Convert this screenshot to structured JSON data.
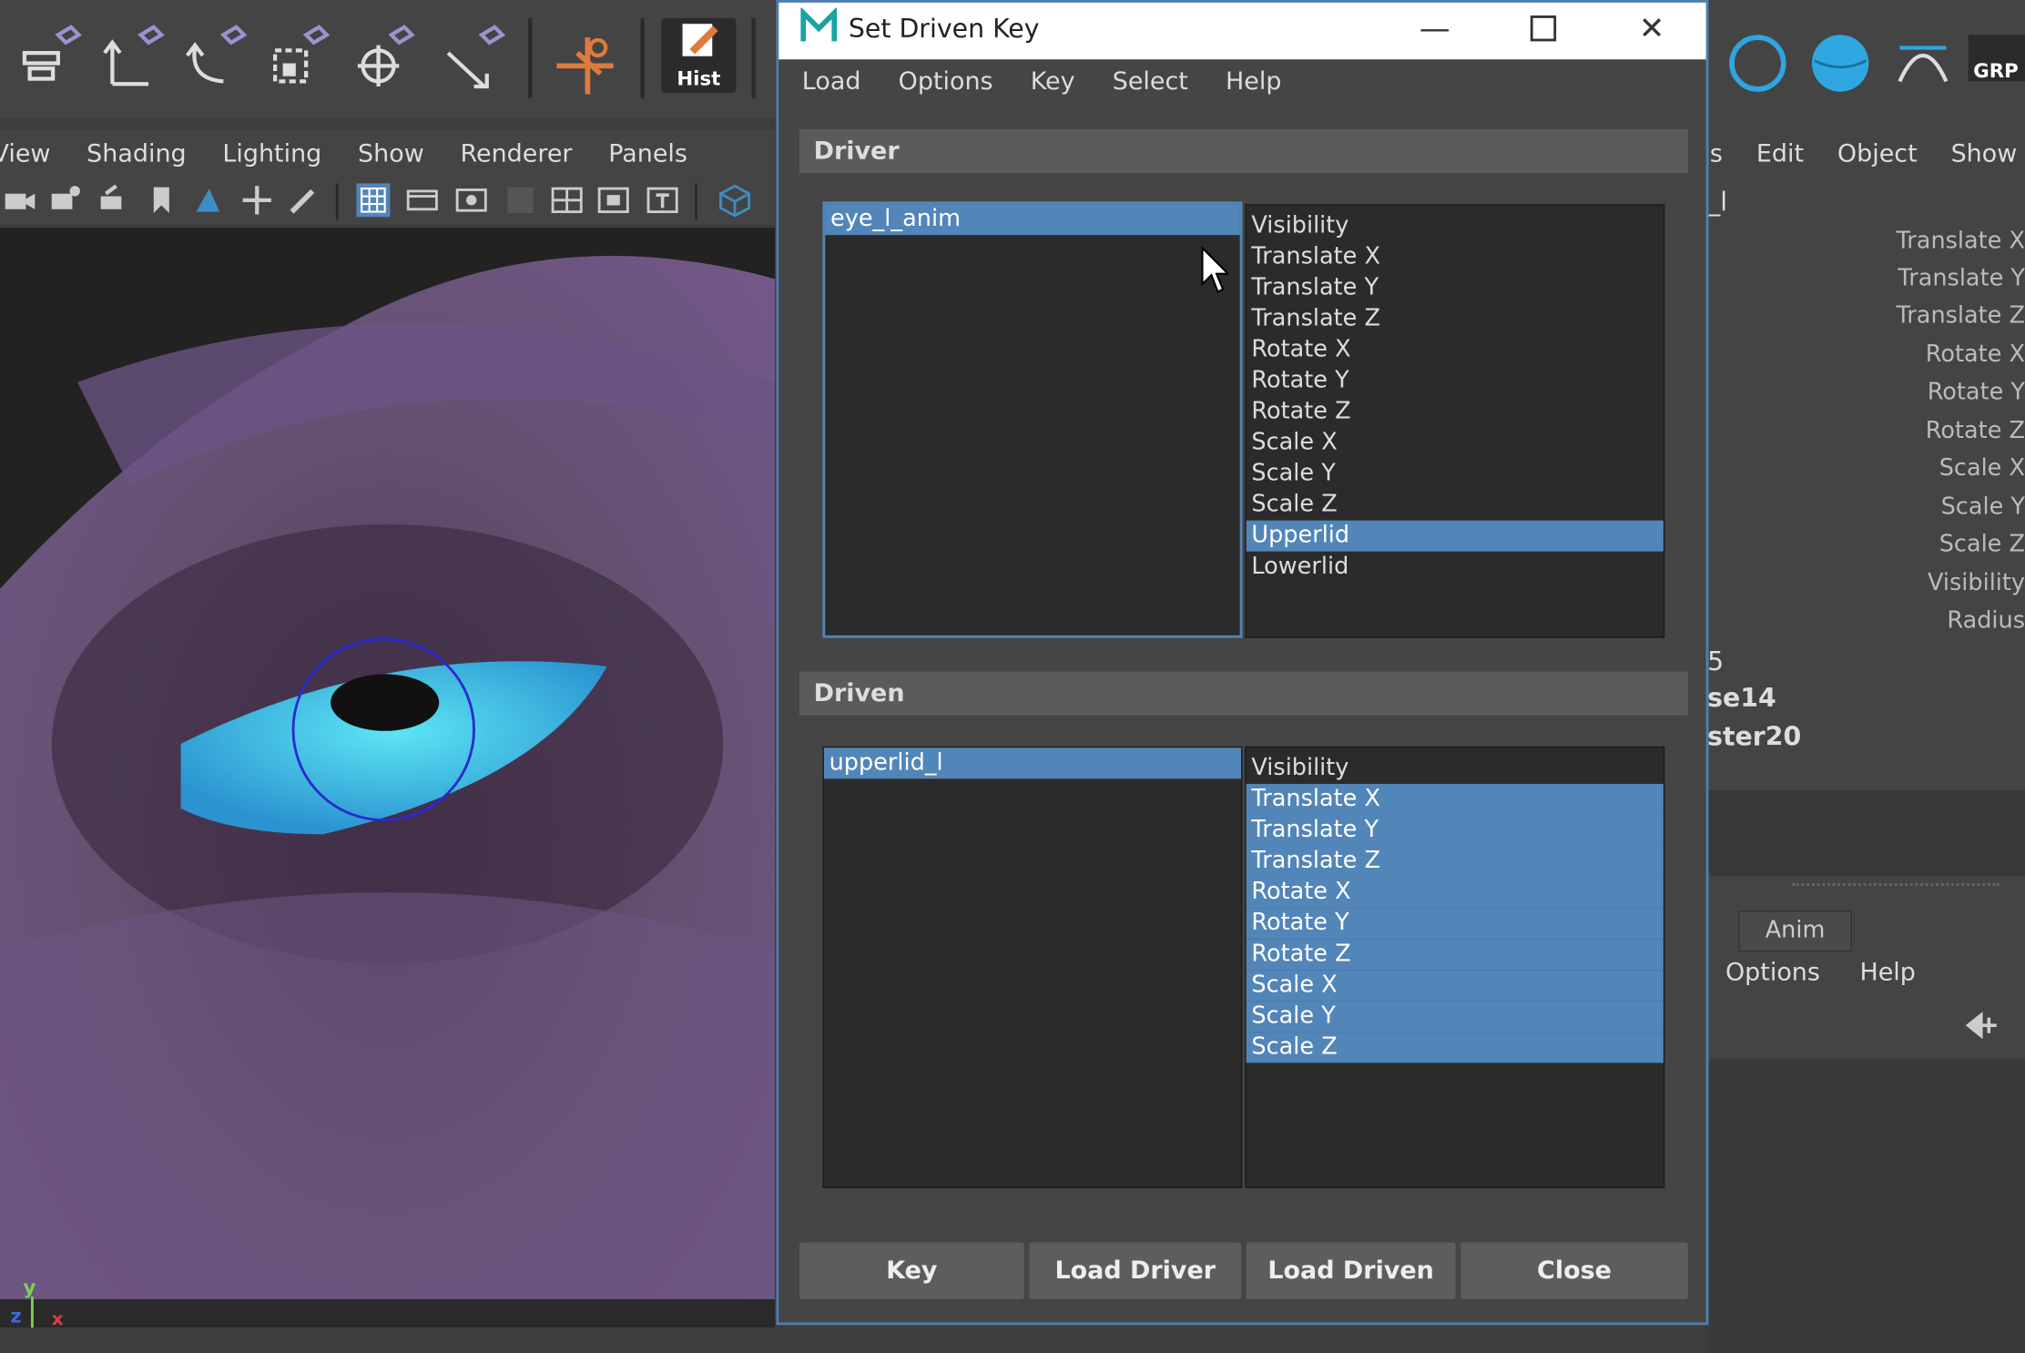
{
  "shelf": {
    "hist_label": "Hist",
    "grp_label": "GRP"
  },
  "viewport": {
    "menu": [
      "View",
      "Shading",
      "Lighting",
      "Show",
      "Renderer",
      "Panels"
    ],
    "axis_y": "y",
    "axis_z": "z",
    "axis_x": "x"
  },
  "right_panel": {
    "menu": [
      "s",
      "Edit",
      "Object",
      "Show"
    ],
    "channels": [
      "Translate X",
      "Translate Y",
      "Translate Z",
      "Rotate X",
      "Rotate Y",
      "Rotate Z",
      "Scale X",
      "Scale Y",
      "Scale Z",
      "Visibility",
      "Radius"
    ],
    "outliner_partial": [
      "_l",
      "5",
      "se14",
      "ster20"
    ],
    "tab_anim": "Anim",
    "lower_menu": [
      "Options",
      "Help"
    ]
  },
  "dialog": {
    "title": "Set Driven Key",
    "menu": [
      "Load",
      "Options",
      "Key",
      "Select",
      "Help"
    ],
    "driver": {
      "heading": "Driver",
      "objects": [
        "eye_l_anim"
      ],
      "attributes": [
        "Visibility",
        "Translate X",
        "Translate Y",
        "Translate Z",
        "Rotate X",
        "Rotate Y",
        "Rotate Z",
        "Scale X",
        "Scale Y",
        "Scale Z",
        "Upperlid",
        "Lowerlid"
      ]
    },
    "driven": {
      "heading": "Driven",
      "objects": [
        "upperlid_l"
      ],
      "attributes": [
        "Visibility",
        "Translate X",
        "Translate Y",
        "Translate Z",
        "Rotate X",
        "Rotate Y",
        "Rotate Z",
        "Scale X",
        "Scale Y",
        "Scale Z"
      ]
    },
    "buttons": {
      "key": "Key",
      "load_driver": "Load Driver",
      "load_driven": "Load Driven",
      "close": "Close"
    }
  },
  "colors": {
    "selection": "#5285b8",
    "dialog_border": "#4f7fb0",
    "eye": "#2ab8e0"
  }
}
